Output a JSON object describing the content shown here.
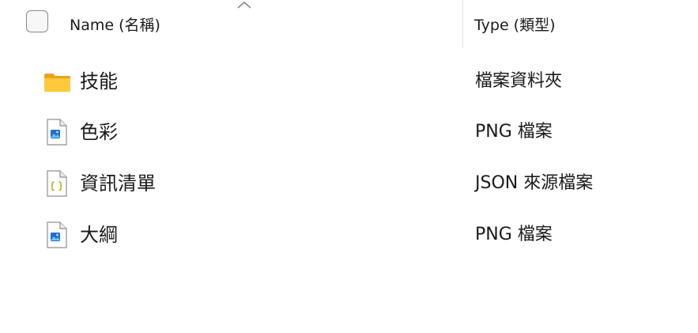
{
  "header": {
    "name_label": "Name (名稱)",
    "type_label": "Type (類型)"
  },
  "files": [
    {
      "name": "技能",
      "type": "檔案資料夾",
      "icon": "folder-icon"
    },
    {
      "name": "色彩",
      "type": "PNG 檔案",
      "icon": "image-file-icon"
    },
    {
      "name": "資訊清單",
      "type": "JSON 來源檔案",
      "icon": "json-file-icon"
    },
    {
      "name": "大綱",
      "type": "PNG 檔案",
      "icon": "image-file-icon"
    }
  ],
  "colors": {
    "folder": "#f4c542",
    "image_accent": "#1f6fd1",
    "json_accent": "#b6a400"
  }
}
